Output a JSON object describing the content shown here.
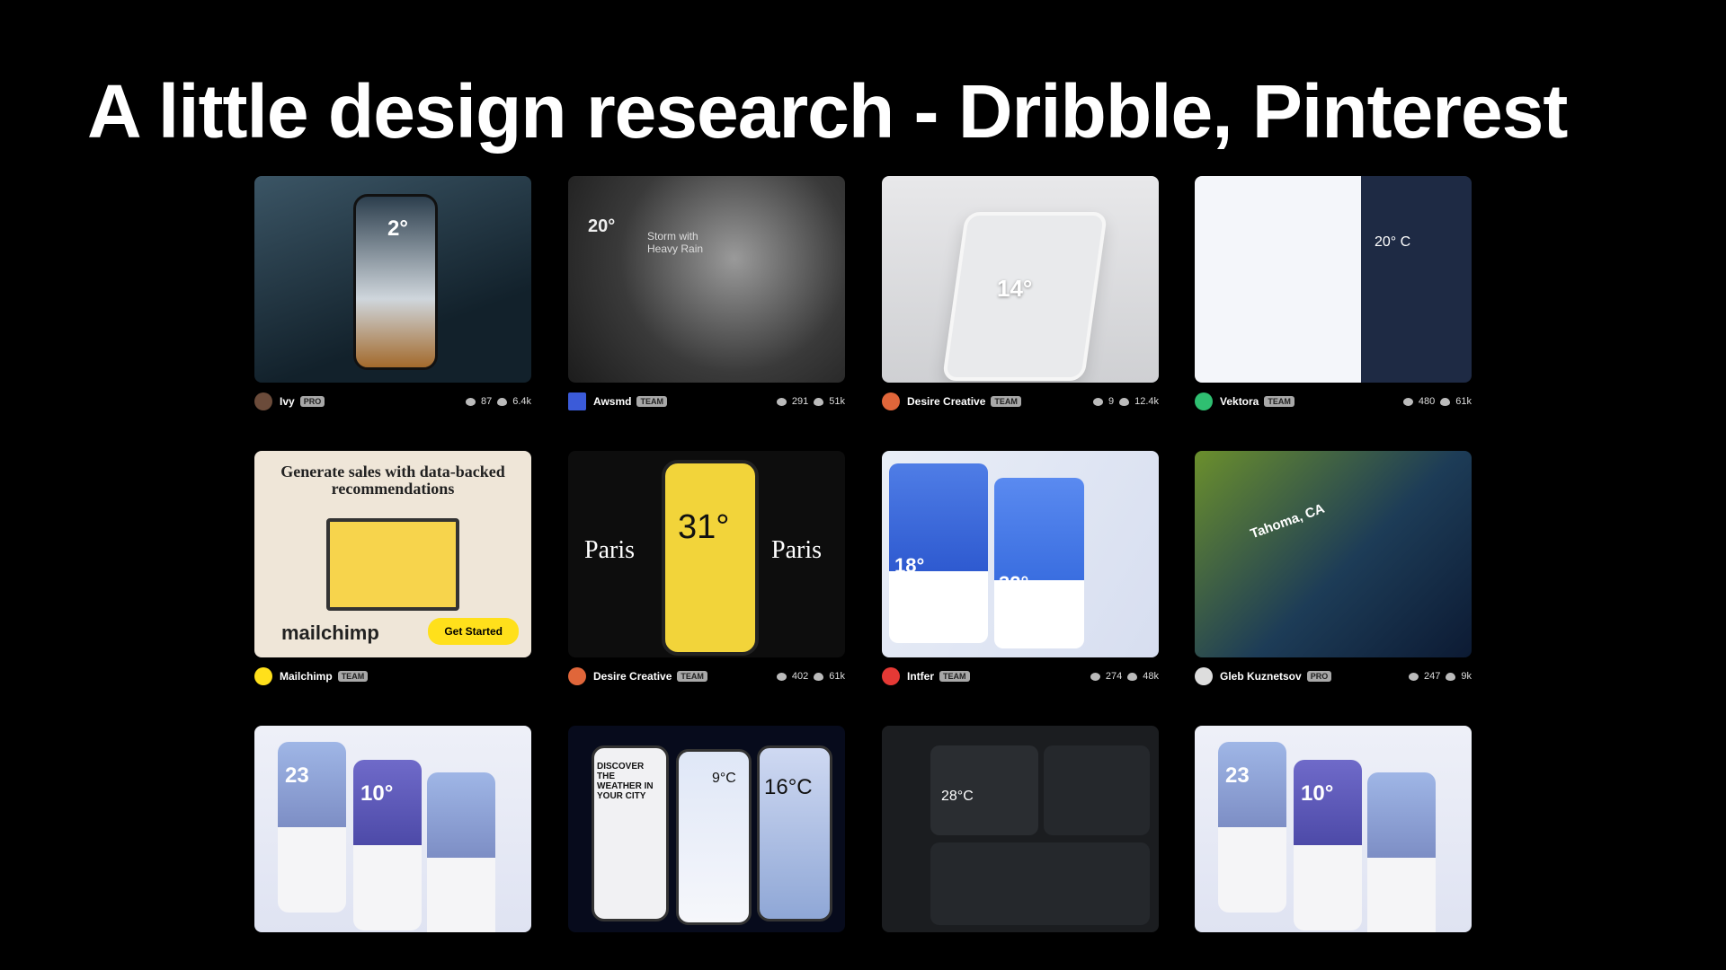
{
  "title": "A little design research - Dribble, Pinterest",
  "cards": [
    {
      "author": "Ivy",
      "badge": "PRO",
      "likes": "87",
      "views": "6.4k",
      "avatar_color": "#6b4b3a",
      "big": "2°"
    },
    {
      "author": "Awsmd",
      "badge": "TEAM",
      "likes": "291",
      "views": "51k",
      "avatar_color": "#3b5bd9",
      "big": "20°",
      "subtitle": "Storm with Heavy Rain"
    },
    {
      "author": "Desire Creative",
      "badge": "TEAM",
      "likes": "9",
      "views": "12.4k",
      "avatar_color": "#e0663a",
      "big": "14°"
    },
    {
      "author": "Vektora",
      "badge": "TEAM",
      "likes": "480",
      "views": "61k",
      "avatar_color": "#2fbf71",
      "big": "20° C"
    },
    {
      "author": "Mailchimp",
      "badge": "TEAM",
      "likes": "",
      "views": "",
      "avatar_color": "#ffe01b",
      "headline": "Generate sales with data-backed recommendations",
      "cta": "Get Started",
      "brand": "mailchimp"
    },
    {
      "author": "Desire Creative",
      "badge": "TEAM",
      "likes": "402",
      "views": "61k",
      "avatar_color": "#e0663a",
      "big": "31°",
      "city": "Paris"
    },
    {
      "author": "Intfer",
      "badge": "TEAM",
      "likes": "274",
      "views": "48k",
      "avatar_color": "#e53935",
      "big": "18°",
      "big2": "32°"
    },
    {
      "author": "Gleb Kuznetsov",
      "badge": "PRO",
      "likes": "247",
      "views": "9k",
      "avatar_color": "#dddddd",
      "city": "Tahoma, CA"
    },
    {
      "author": "",
      "badge": "",
      "likes": "",
      "views": "",
      "avatar_color": "",
      "big": "23",
      "big2": "10°"
    },
    {
      "author": "",
      "badge": "",
      "likes": "",
      "views": "",
      "avatar_color": "",
      "big": "9°C",
      "big2": "16°C",
      "subtitle": "DISCOVER THE WEATHER IN YOUR CITY"
    },
    {
      "author": "",
      "badge": "",
      "likes": "",
      "views": "",
      "avatar_color": "",
      "big": "28°C"
    },
    {
      "author": "",
      "badge": "",
      "likes": "",
      "views": "",
      "avatar_color": "",
      "big": "23",
      "big2": "10°"
    }
  ]
}
